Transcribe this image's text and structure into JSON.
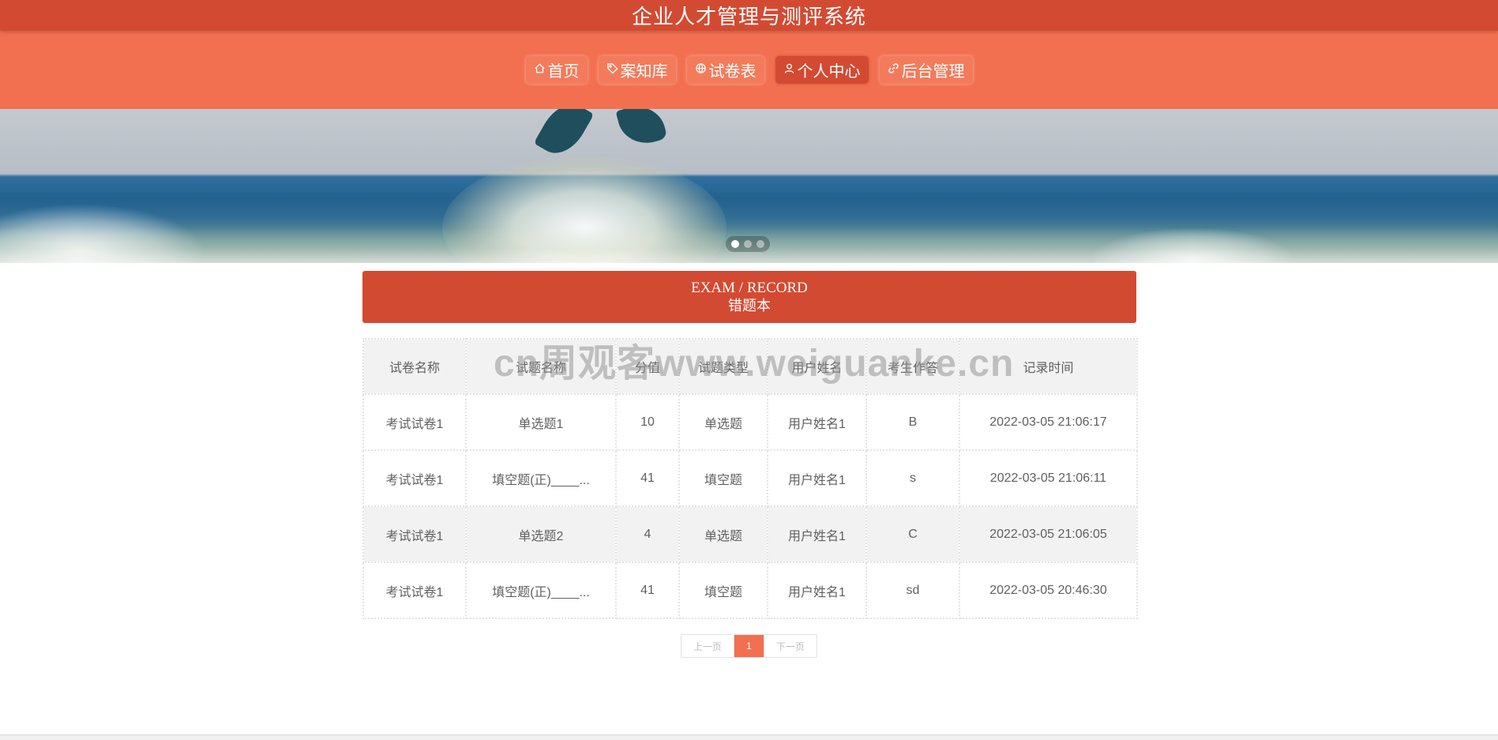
{
  "app": {
    "title": "企业人才管理与测评系统"
  },
  "nav": {
    "items": [
      {
        "label": "首页",
        "icon": "home-icon",
        "active": false
      },
      {
        "label": "案知库",
        "icon": "tag-icon",
        "active": false
      },
      {
        "label": "试卷表",
        "icon": "globe-icon",
        "active": false
      },
      {
        "label": "个人中心",
        "icon": "user-icon",
        "active": true
      },
      {
        "label": "后台管理",
        "icon": "link-icon",
        "active": false
      }
    ]
  },
  "banner": {
    "slide_count": 3,
    "active_slide": 1
  },
  "section": {
    "title_en": "EXAM / RECORD",
    "title_cn": "错题本"
  },
  "table": {
    "headers": [
      "试卷名称",
      "试题名称",
      "分值",
      "试题类型",
      "用户姓名",
      "考生作答",
      "记录时间"
    ],
    "rows": [
      [
        "考试试卷1",
        "单选题1",
        "10",
        "单选题",
        "用户姓名1",
        "B",
        "2022-03-05 21:06:17"
      ],
      [
        "考试试卷1",
        "填空题(正)____...",
        "41",
        "填空题",
        "用户姓名1",
        "s",
        "2022-03-05 21:06:11"
      ],
      [
        "考试试卷1",
        "单选题2",
        "4",
        "单选题",
        "用户姓名1",
        "C",
        "2022-03-05 21:06:05"
      ],
      [
        "考试试卷1",
        "填空题(正)____...",
        "41",
        "填空题",
        "用户姓名1",
        "sd",
        "2022-03-05 20:46:30"
      ]
    ]
  },
  "watermark": "cn周观客www.weiguanke.cn",
  "pagination": {
    "prev": "上一页",
    "current": "1",
    "next": "下一页"
  },
  "colors": {
    "primary": "#d34a32",
    "nav_bg": "#f2704f"
  }
}
